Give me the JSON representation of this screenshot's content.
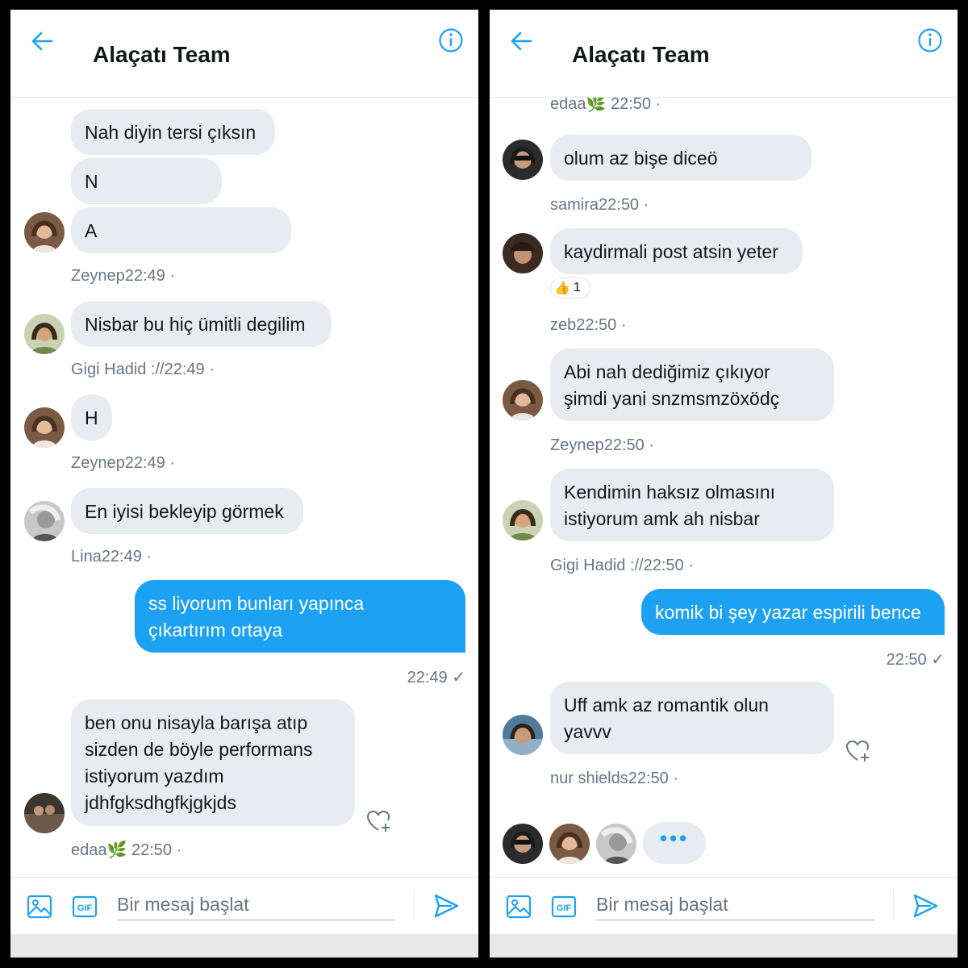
{
  "colors": {
    "accent": "#1da1f2",
    "bubble_other": "#e6ecf0",
    "meta_text": "#657786",
    "frame": "#000000"
  },
  "left": {
    "title": "Alaçatı Team",
    "messages": [
      {
        "text": "Nah diyin tersi çıksın"
      },
      {
        "text": "N"
      },
      {
        "text": "A"
      },
      {
        "meta": "Zeynep22:49 ·"
      },
      {
        "text": "Nisbar bu hiç ümitli degilim",
        "meta": "Gigi Hadid ://22:49 ·"
      },
      {
        "text": "H",
        "meta": "Zeynep22:49 ·"
      },
      {
        "text": "En iyisi bekleyip görmek",
        "meta": "Lina22:49 ·"
      },
      {
        "text": "ss liyorum bunları yapınca\nçıkartırım ortaya",
        "meta": "22:49 ✓"
      },
      {
        "text": "ben onu nisayla barışa atıp\nsizden de böyle performans\nistiyorum yazdım\njdhfgksdhgfkjgkjds",
        "meta": "edaa🌿 22:50 ·"
      }
    ],
    "composer": {
      "placeholder": "Bir mesaj başlat"
    }
  },
  "right": {
    "title": "Alaçatı Team",
    "top_meta": "edaa🌿 22:50 ·",
    "messages": [
      {
        "text": "olum az bişe diceö",
        "meta": "samira22:50 ·"
      },
      {
        "text": "kaydirmali post atsin yeter",
        "meta": "zeb22:50 ·",
        "reaction": {
          "emoji": "👍",
          "count": "1"
        }
      },
      {
        "text": "Abi nah dediğimiz çıkıyor\nşimdi yani snzmsmzöxödç",
        "meta": "Zeynep22:50 ·"
      },
      {
        "text": "Kendimin haksız olmasını\nistiyorum amk ah nisbar",
        "meta": "Gigi Hadid ://22:50 ·"
      },
      {
        "text": "komik bi şey yazar espirili bence",
        "meta": "22:50 ✓"
      },
      {
        "text": "Uff amk az romantik olun\nyavvv",
        "meta": "nur shields22:50 ·"
      }
    ],
    "typing": "•••",
    "composer": {
      "placeholder": "Bir mesaj başlat"
    }
  },
  "icons": [
    "back-arrow-icon",
    "info-icon",
    "image-icon",
    "gif-icon",
    "send-icon",
    "heart-plus-icon",
    "thumbs-up-icon"
  ]
}
